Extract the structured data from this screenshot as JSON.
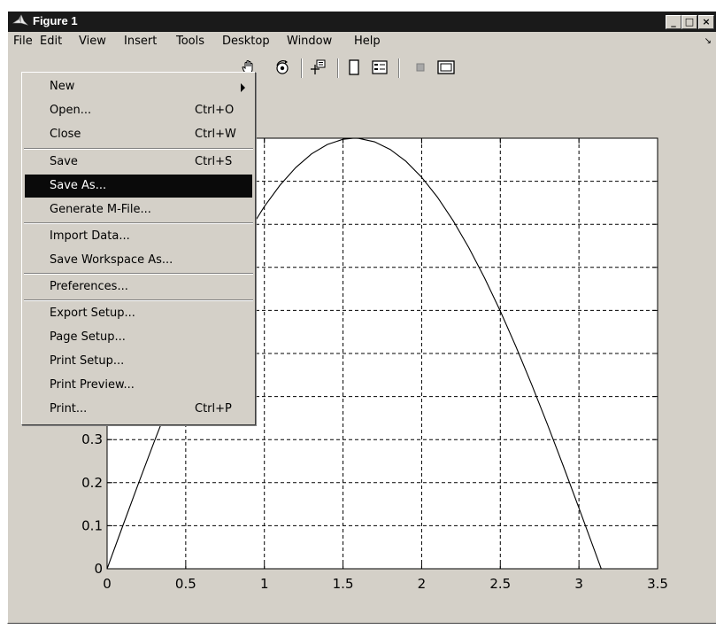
{
  "window": {
    "title": "Figure 1",
    "controls": {
      "minimize": "_",
      "maximize": "□",
      "close": "×"
    }
  },
  "menubar": {
    "items": [
      "File",
      "Edit",
      "View",
      "Insert",
      "Tools",
      "Desktop",
      "Window",
      "Help"
    ],
    "chevron": "↘"
  },
  "toolbar": {
    "icons": [
      "pan-hand-icon",
      "rotate-3d-icon",
      "data-cursor-icon",
      "colorbar-icon",
      "legend-icon",
      "hide-plot-tools-icon",
      "show-plot-tools-icon"
    ]
  },
  "file_menu": {
    "items": [
      {
        "label": "New",
        "shortcut": "",
        "submenu": true
      },
      {
        "label": "Open...",
        "shortcut": "Ctrl+O"
      },
      {
        "label": "Close",
        "shortcut": "Ctrl+W"
      },
      {
        "label": "Save",
        "shortcut": "Ctrl+S"
      },
      {
        "label": "Save As...",
        "shortcut": "",
        "highlighted": true
      },
      {
        "label": "Generate M-File...",
        "shortcut": ""
      },
      {
        "label": "Import Data...",
        "shortcut": ""
      },
      {
        "label": "Save Workspace As...",
        "shortcut": ""
      },
      {
        "label": "Preferences...",
        "shortcut": ""
      },
      {
        "label": "Export Setup...",
        "shortcut": ""
      },
      {
        "label": "Page Setup...",
        "shortcut": ""
      },
      {
        "label": "Print Setup...",
        "shortcut": ""
      },
      {
        "label": "Print Preview...",
        "shortcut": ""
      },
      {
        "label": "Print...",
        "shortcut": "Ctrl+P"
      }
    ]
  },
  "chart_data": {
    "type": "line",
    "title": "",
    "xlabel": "",
    "ylabel": "",
    "xlim": [
      0,
      3.5
    ],
    "ylim": [
      0,
      1
    ],
    "grid": true,
    "grid_style": "dashed",
    "x_ticks": [
      "0",
      "0.5",
      "1",
      "1.5",
      "2",
      "2.5",
      "3",
      "3.5"
    ],
    "y_ticks_visible": [
      "0",
      "0.1",
      "0.2",
      "0.3"
    ],
    "series": [
      {
        "color": "#000000",
        "x": [
          0,
          0.1,
          0.2,
          0.3,
          0.4,
          0.5,
          0.6,
          0.7,
          0.8,
          0.9,
          1.0,
          1.1,
          1.2,
          1.3,
          1.4,
          1.5,
          1.5708,
          1.6,
          1.7,
          1.8,
          1.9,
          2.0,
          2.1,
          2.2,
          2.3,
          2.4,
          2.5,
          2.6,
          2.7,
          2.8,
          2.9,
          3.0,
          3.1,
          3.1416
        ],
        "y": [
          0,
          0.0998,
          0.1987,
          0.2955,
          0.3894,
          0.4794,
          0.5646,
          0.6442,
          0.7174,
          0.7833,
          0.8415,
          0.8912,
          0.932,
          0.9636,
          0.9854,
          0.9975,
          1.0,
          0.9996,
          0.9917,
          0.9738,
          0.9463,
          0.9093,
          0.8632,
          0.8085,
          0.7457,
          0.6755,
          0.5985,
          0.5155,
          0.4274,
          0.335,
          0.2392,
          0.1411,
          0.0416,
          0
        ]
      }
    ]
  }
}
